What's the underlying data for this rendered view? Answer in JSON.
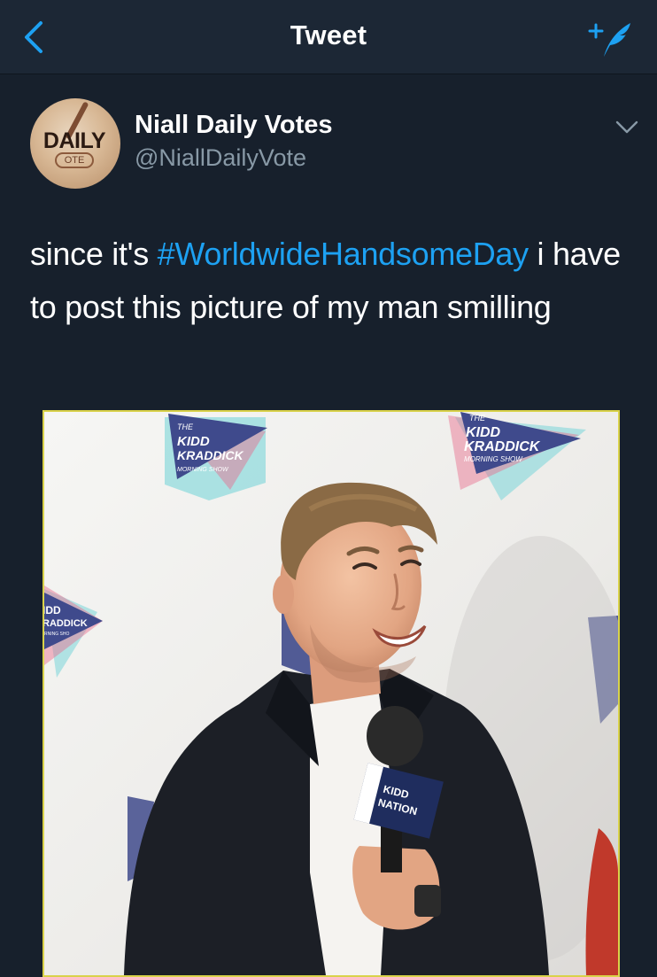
{
  "navbar": {
    "title": "Tweet",
    "back_icon": "chevron-left-icon",
    "compose_icon": "compose-tweet-icon",
    "accent_color": "#1da1f2"
  },
  "tweet": {
    "display_name": "Niall Daily Votes",
    "handle": "@NiallDailyVote",
    "avatar_text": "DAILY",
    "avatar_subtext": "OTE",
    "text_before": "since it's ",
    "hashtag": "#WorldwideHandsomeDay",
    "text_after": " i have to post this picture of my man smilling",
    "more_icon": "chevron-down-icon"
  },
  "media": {
    "backdrop_logo_the": "THE",
    "backdrop_logo_line1": "KIDD",
    "backdrop_logo_line2": "KRADDICK",
    "backdrop_logo_line3": "MORNING SHOW",
    "left_logo_line1": "IDD",
    "left_logo_line2": "RADDICK",
    "left_logo_line3": "RNING SHO",
    "mic_flag_line1": "KIDD",
    "mic_flag_line2": "NATION"
  },
  "colors": {
    "background": "#17202c",
    "navbar": "#1c2735",
    "secondary_text": "#8899a6",
    "link": "#1da1f2"
  }
}
